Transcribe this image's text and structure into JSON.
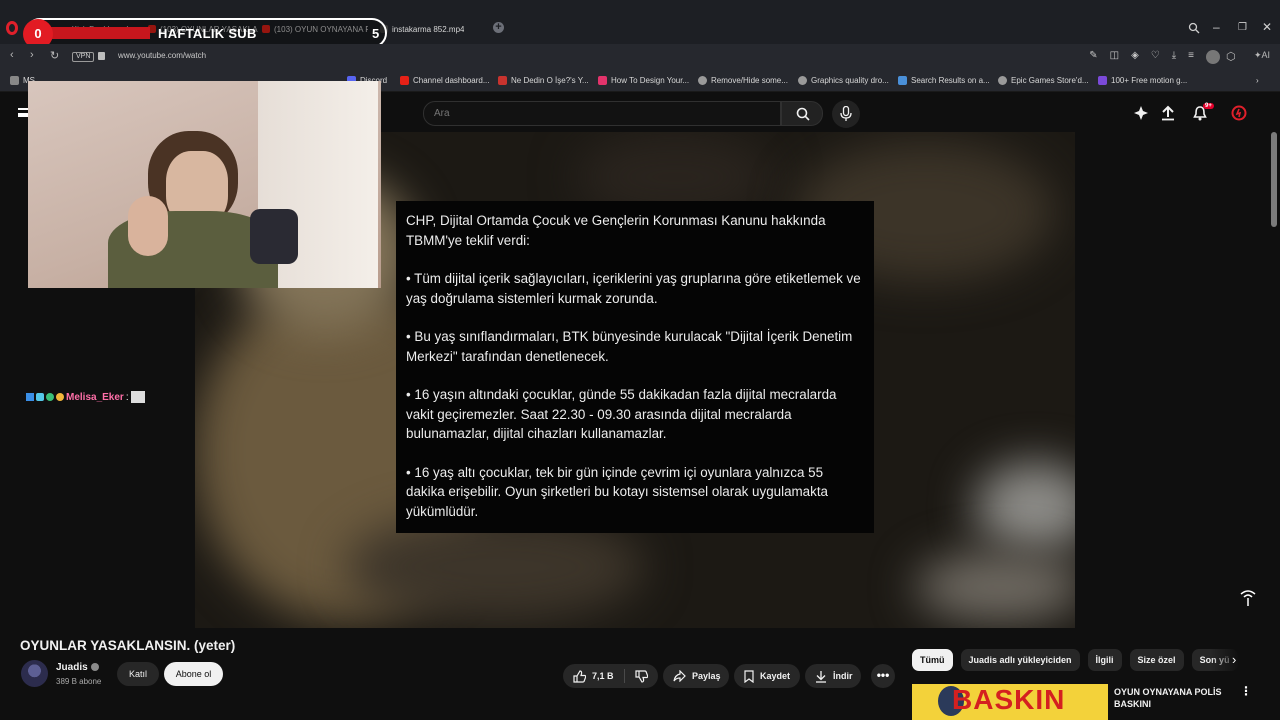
{
  "browser": {
    "tabs": [
      {
        "label": "m - Kick Dashboard"
      },
      {
        "label": "(103) OYUNLAR YASAKLA..."
      },
      {
        "label": "(103) OYUN OYNAYANA P..."
      },
      {
        "label": "instakarma 852.mp4"
      }
    ],
    "url": "www.youtube.com/watch",
    "vpn_label": "VPN",
    "bookmarks": [
      {
        "label": "MS..."
      },
      {
        "label": "Discord"
      },
      {
        "label": "Channel dashboard..."
      },
      {
        "label": "Ne Dedin O İşe?'s Y..."
      },
      {
        "label": "How To Design Your..."
      },
      {
        "label": "Remove/Hide some..."
      },
      {
        "label": "Graphics quality dro..."
      },
      {
        "label": "Search Results on a..."
      },
      {
        "label": "Epic Games Store'd..."
      },
      {
        "label": "100+ Free motion g..."
      }
    ]
  },
  "stream_overlay": {
    "left_counter": "0",
    "title": "HAFTALIK SUB",
    "right_counter": "5"
  },
  "chat": {
    "username": "Melisa_Eker",
    "separator": ":"
  },
  "youtube": {
    "search_placeholder": "Ara",
    "notification_badge": "9+",
    "news_card": {
      "paragraphs": [
        "CHP, Dijital Ortamda Çocuk ve Gençlerin Korunması Kanunu hakkında TBMM'ye teklif verdi:",
        "• Tüm dijital içerik sağlayıcıları, içeriklerini yaş gruplarına göre etiketlemek ve yaş doğrulama sistemleri kurmak zorunda.",
        "• Bu yaş sınıflandırmaları, BTK bünyesinde kurulacak \"Dijital İçerik Denetim Merkezi\" tarafından denetlenecek.",
        "• 16 yaşın altındaki çocuklar, günde 55 dakikadan fazla dijital mecralarda vakit geçiremezler. Saat 22.30 - 09.30 arasında dijital mecralarda bulunamazlar, dijital cihazları kullanamazlar.",
        "• 16 yaş altı çocuklar, tek bir gün içinde çevrim içi oyunlara yalnızca 55 dakika erişebilir. Oyun şirketleri bu kotayı sistemsel olarak uygulamakta yükümlüdür."
      ]
    },
    "video": {
      "title": "OYUNLAR YASAKLANSIN. (yeter)",
      "channel_name": "Juadis",
      "subscribers": "389 B abone",
      "join_label": "Katıl",
      "subscribe_label": "Abone ol",
      "like_count": "7,1 B",
      "share_label": "Paylaş",
      "save_label": "Kaydet",
      "download_label": "İndir",
      "more_label": "•••"
    },
    "chips": [
      {
        "label": "Tümü"
      },
      {
        "label": "Juadis adlı yükleyiciden"
      },
      {
        "label": "İlgili"
      },
      {
        "label": "Size özel"
      },
      {
        "label": "Son yü"
      }
    ],
    "recommendation": {
      "thumb_text": "BASKIN",
      "title": "OYUN OYNAYANA POLİS BASKINI"
    }
  }
}
